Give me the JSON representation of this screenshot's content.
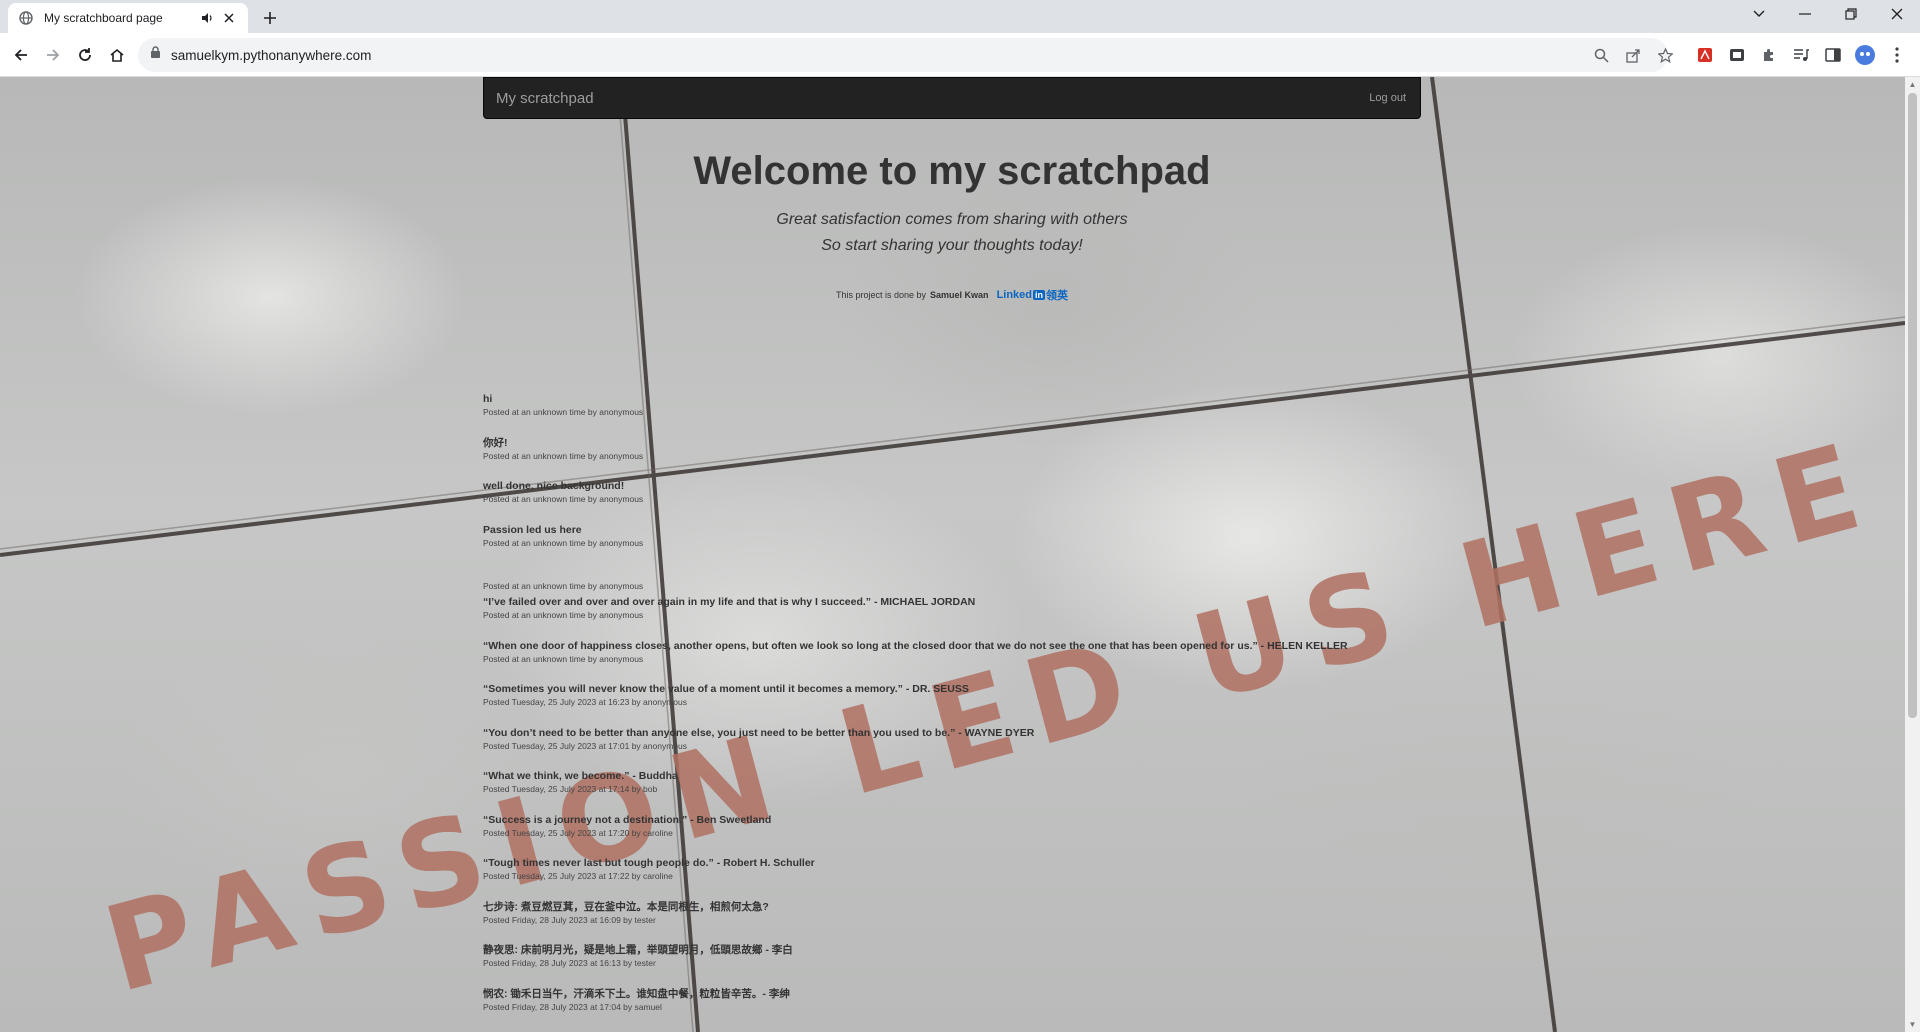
{
  "browser": {
    "tab_title": "My scratchboard page",
    "url": "samuelkym.pythonanywhere.com"
  },
  "navbar": {
    "brand": "My scratchpad",
    "logout": "Log out"
  },
  "hero": {
    "title": "Welcome to my scratchpad",
    "subtitle_line1": "Great satisfaction comes from sharing with others",
    "subtitle_line2": "So start sharing your thoughts today!",
    "credit_prefix": "This project is done by",
    "credit_author": "Samuel Kwan",
    "linkedin_pre": "Linked",
    "linkedin_in": "in",
    "linkedin_cn": "领英"
  },
  "background_text": "PASSION LED US HERE",
  "posts": [
    {
      "text": "hi",
      "meta": "Posted at an unknown time by anonymous"
    },
    {
      "text": "你好!",
      "meta": "Posted at an unknown time by anonymous"
    },
    {
      "text": "well done, nice background!",
      "meta": "Posted at an unknown time by anonymous"
    },
    {
      "text": "Passion led us here",
      "meta": "Posted at an unknown time by anonymous"
    },
    {
      "text": "",
      "meta": "Posted at an unknown time by anonymous"
    },
    {
      "text": "“I’ve failed over and over and over again in my life and that is why I succeed.” - MICHAEL JORDAN",
      "meta": "Posted at an unknown time by anonymous"
    },
    {
      "text": "“When one door of happiness closes, another opens, but often we look so long at the closed door that we do not see the one that has been opened for us.” - HELEN KELLER",
      "meta": "Posted at an unknown time by anonymous"
    },
    {
      "text": "“Sometimes you will never know the value of a moment until it becomes a memory.” - DR. SEUSS",
      "meta": "Posted Tuesday, 25 July 2023 at 16:23 by anonymous"
    },
    {
      "text": "“You don’t need to be better than anyone else, you just need to be better than you used to be.” - WAYNE DYER",
      "meta": "Posted Tuesday, 25 July 2023 at 17:01 by anonymous"
    },
    {
      "text": "“What we think, we become.” - Buddha",
      "meta": "Posted Tuesday, 25 July 2023 at 17:14 by bob"
    },
    {
      "text": "“Success is a journey not a destination.” - Ben Sweetland",
      "meta": "Posted Tuesday, 25 July 2023 at 17:20 by caroline"
    },
    {
      "text": "“Tough times never last but tough people do.” - Robert H. Schuller",
      "meta": "Posted Tuesday, 25 July 2023 at 17:22 by caroline"
    },
    {
      "text": "七步诗: 煮豆燃豆萁，豆在釜中泣。本是同根生，相煎何太急?",
      "meta": "Posted Friday, 28 July 2023 at 16:09 by tester"
    },
    {
      "text": "静夜思: 床前明月光，疑是地上霜，举頭望明月，低頭思故鄉 - 李白",
      "meta": "Posted Friday, 28 July 2023 at 16:13 by tester"
    },
    {
      "text": "悯农: 锄禾日当午，汗滴禾下土。谁知盘中餐，粒粒皆辛苦。- 李绅",
      "meta": "Posted Friday, 28 July 2023 at 17:04 by samuel"
    }
  ]
}
